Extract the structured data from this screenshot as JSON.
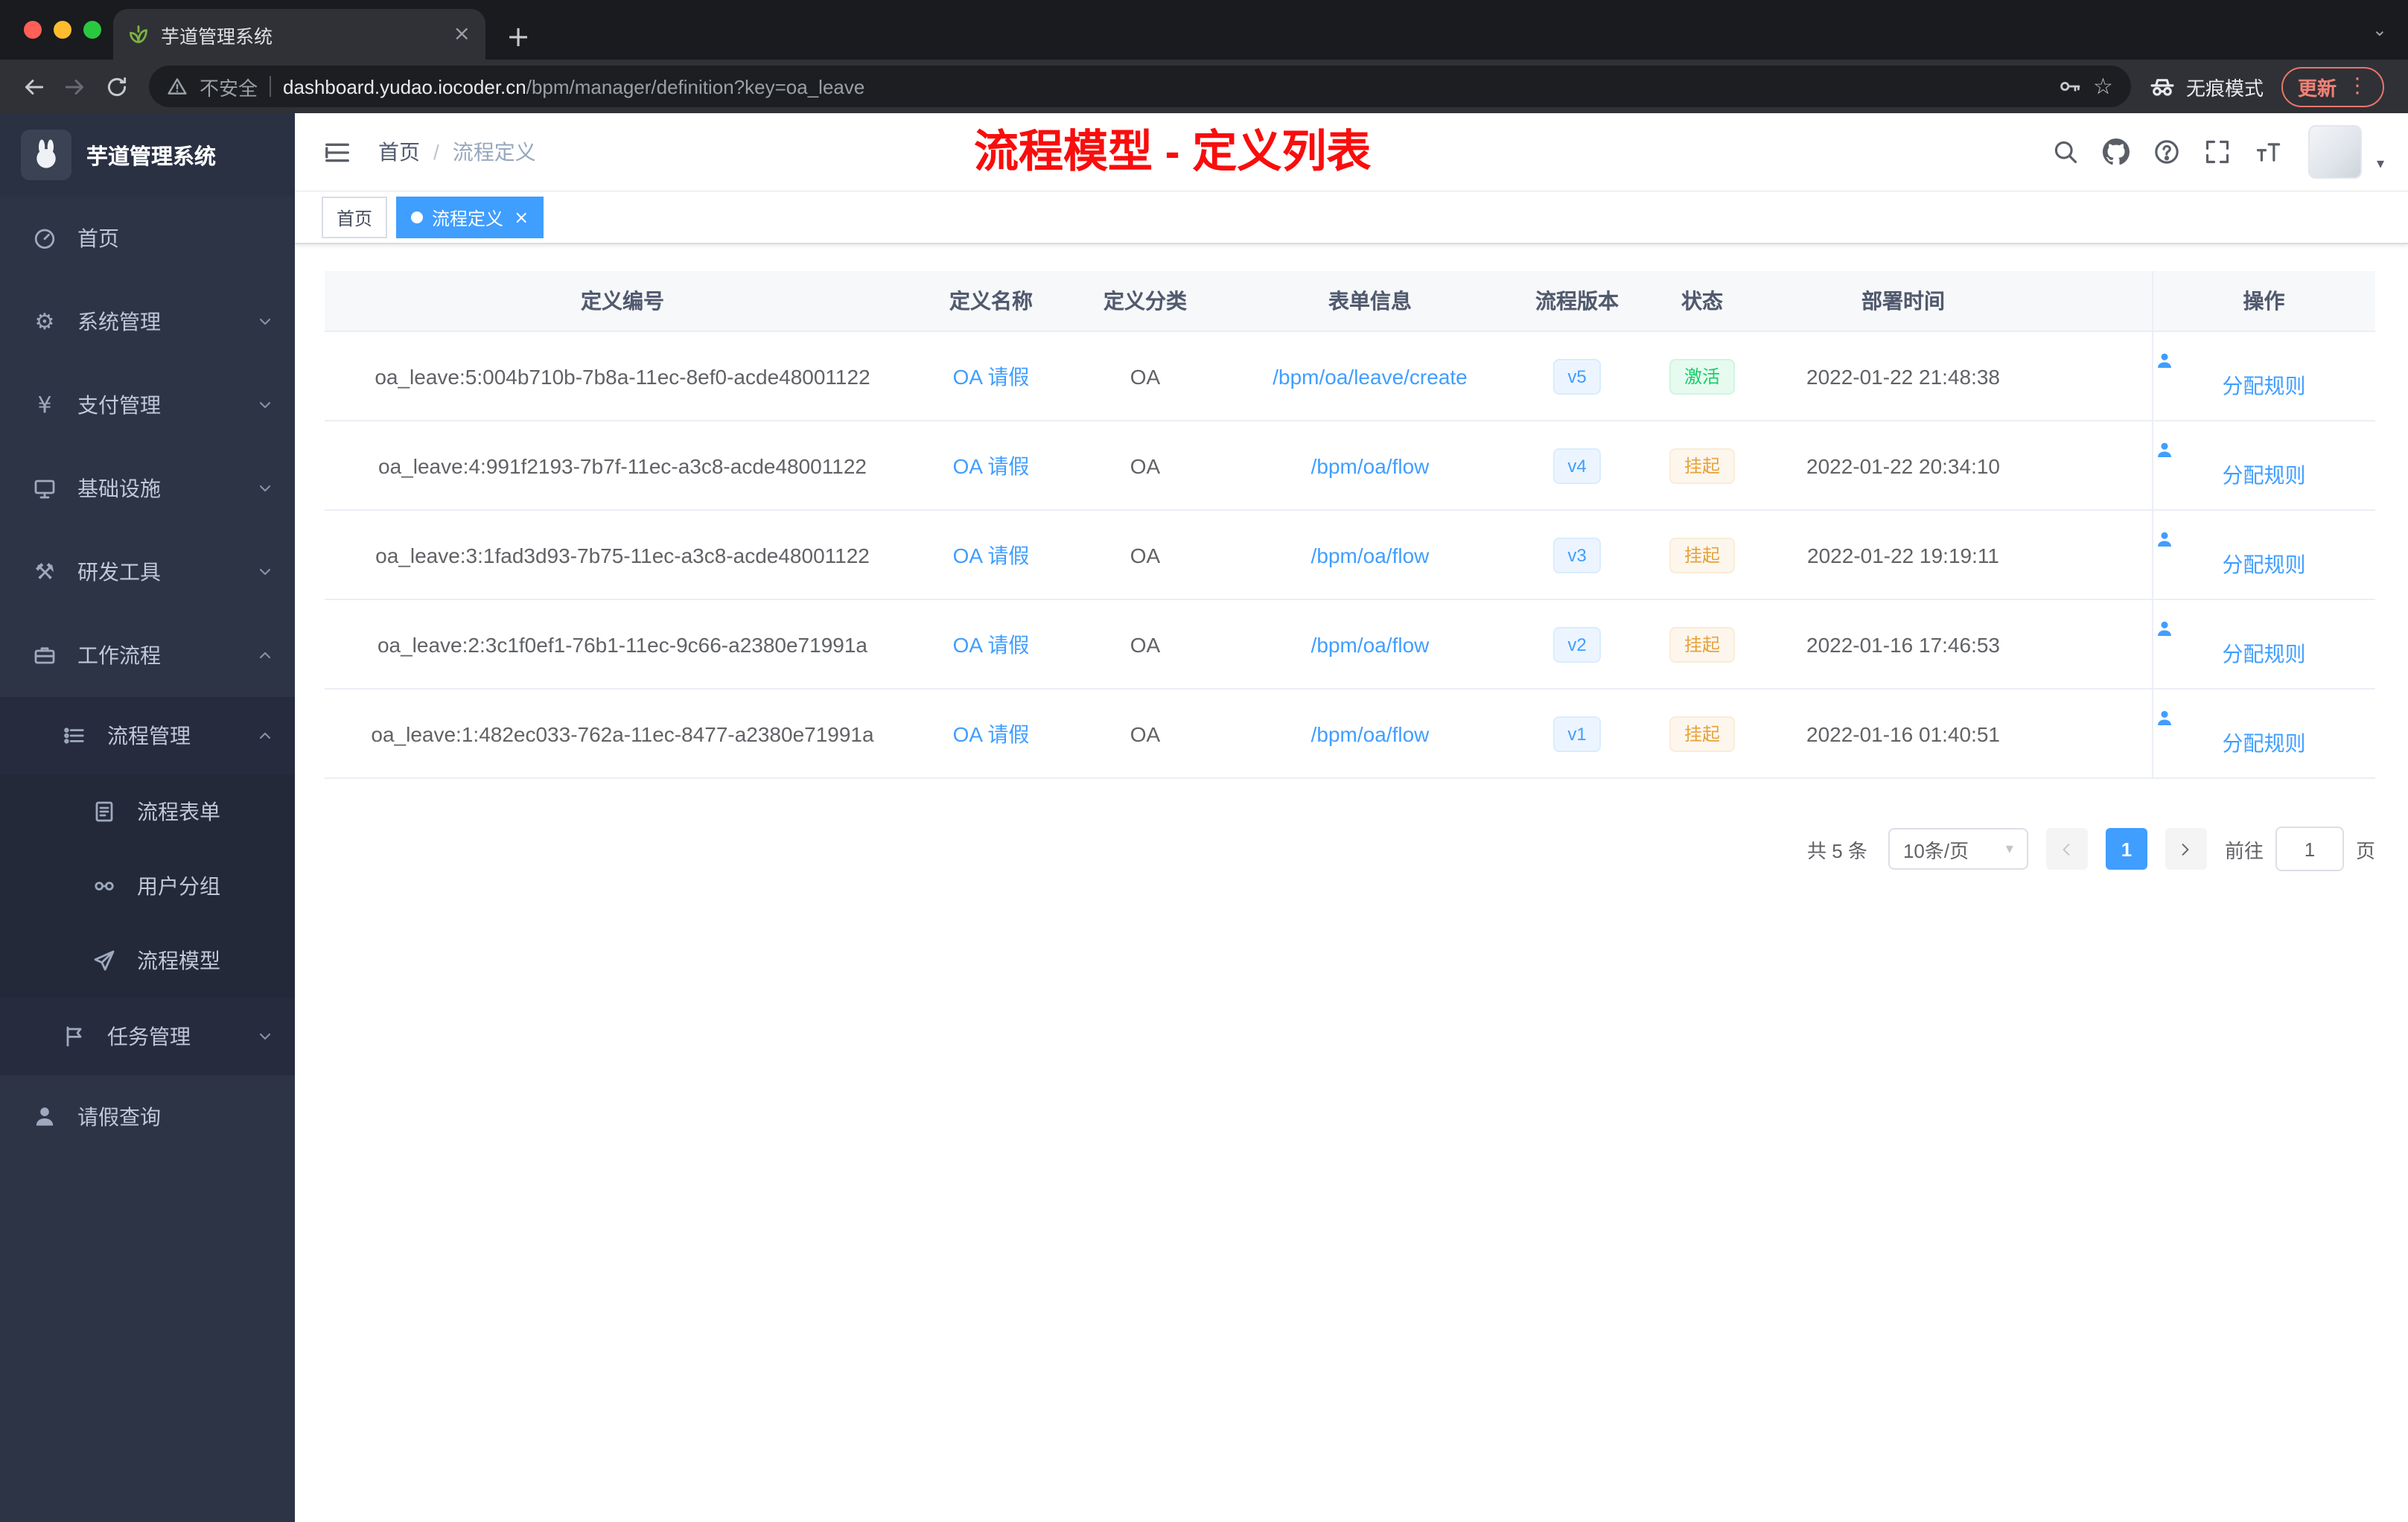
{
  "browser": {
    "tab_title": "芋道管理系统",
    "url_security": "不安全",
    "url_host": "dashboard.yudao.iocoder.cn",
    "url_path": "/bpm/manager/definition?key=oa_leave",
    "incognito_label": "无痕模式",
    "update_button": "更新"
  },
  "glyphs": {
    "new_tab": "+",
    "tab_close": "×",
    "strip_caret": "⌄",
    "dots_menu": "⋮",
    "star": "☆",
    "gear": "⚙",
    "yen": "¥",
    "hammer": "⚒",
    "caret_down": "▾",
    "select_caret": "▼"
  },
  "sidebar": {
    "logo_title": "芋道管理系统",
    "menu": {
      "home": "首页",
      "system": "系统管理",
      "payment": "支付管理",
      "infra": "基础设施",
      "devtools": "研发工具",
      "workflow": "工作流程",
      "process_mgmt": "流程管理",
      "process_form": "流程表单",
      "user_group": "用户分组",
      "process_model": "流程模型",
      "task_mgmt": "任务管理",
      "leave_query": "请假查询"
    }
  },
  "navbar": {
    "breadcrumb_home": "首页",
    "breadcrumb_sep": "/",
    "breadcrumb_current": "流程定义",
    "annotation": "流程模型 - 定义列表"
  },
  "tags_view": {
    "tags": [
      {
        "label": "首页",
        "active": false
      },
      {
        "label": "流程定义",
        "active": true
      }
    ]
  },
  "table": {
    "columns": [
      "定义编号",
      "定义名称",
      "定义分类",
      "表单信息",
      "流程版本",
      "状态",
      "部署时间",
      "操作"
    ],
    "rows": [
      {
        "id": "oa_leave:5:004b710b-7b8a-11ec-8ef0-acde48001122",
        "name": "OA 请假",
        "category": "OA",
        "form": "/bpm/oa/leave/create",
        "version": "v5",
        "status": "激活",
        "status_type": "success",
        "deploy_time": "2022-01-22 21:48:38",
        "action": "分配规则"
      },
      {
        "id": "oa_leave:4:991f2193-7b7f-11ec-a3c8-acde48001122",
        "name": "OA 请假",
        "category": "OA",
        "form": "/bpm/oa/flow",
        "version": "v4",
        "status": "挂起",
        "status_type": "warning",
        "deploy_time": "2022-01-22 20:34:10",
        "action": "分配规则"
      },
      {
        "id": "oa_leave:3:1fad3d93-7b75-11ec-a3c8-acde48001122",
        "name": "OA 请假",
        "category": "OA",
        "form": "/bpm/oa/flow",
        "version": "v3",
        "status": "挂起",
        "status_type": "warning",
        "deploy_time": "2022-01-22 19:19:11",
        "action": "分配规则"
      },
      {
        "id": "oa_leave:2:3c1f0ef1-76b1-11ec-9c66-a2380e71991a",
        "name": "OA 请假",
        "category": "OA",
        "form": "/bpm/oa/flow",
        "version": "v2",
        "status": "挂起",
        "status_type": "warning",
        "deploy_time": "2022-01-16 17:46:53",
        "action": "分配规则"
      },
      {
        "id": "oa_leave:1:482ec033-762a-11ec-8477-a2380e71991a",
        "name": "OA 请假",
        "category": "OA",
        "form": "/bpm/oa/flow",
        "version": "v1",
        "status": "挂起",
        "status_type": "warning",
        "deploy_time": "2022-01-16 01:40:51",
        "action": "分配规则"
      }
    ]
  },
  "pagination": {
    "total": "共 5 条",
    "page_size": "10条/页",
    "current_page": "1",
    "goto_label": "前往",
    "goto_value": "1",
    "unit_label": "页"
  },
  "colors": {
    "primary": "#409eff",
    "success": "#13ce66",
    "warning": "#e6a23c",
    "annotation_red": "#f90d0d",
    "sidebar_bg": "#2d3446"
  }
}
